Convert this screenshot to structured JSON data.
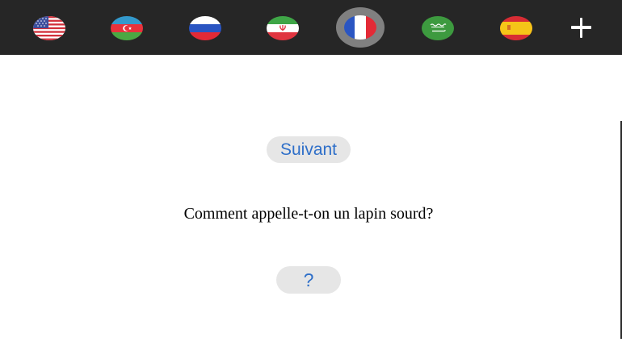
{
  "language_bar": {
    "flags": [
      {
        "icon": "us-flag-icon",
        "language": "English",
        "selected": false
      },
      {
        "icon": "azerbaijan-flag-icon",
        "language": "Azerbaijani",
        "selected": false
      },
      {
        "icon": "russia-flag-icon",
        "language": "Russian",
        "selected": false
      },
      {
        "icon": "iran-flag-icon",
        "language": "Persian",
        "selected": false
      },
      {
        "icon": "france-flag-icon",
        "language": "French",
        "selected": true
      },
      {
        "icon": "saudi-arabia-flag-icon",
        "language": "Arabic",
        "selected": false
      },
      {
        "icon": "spain-flag-icon",
        "language": "Spanish",
        "selected": false
      }
    ],
    "add_icon": "plus-icon"
  },
  "joke": {
    "next_label": "Suivant",
    "question": "Comment appelle-t-on un lapin sourd?",
    "reveal_label": "?"
  },
  "colors": {
    "topbar": "#262626",
    "selected_ring": "#808080",
    "button_bg": "#e6e6e6",
    "button_text": "#2e6fc9"
  }
}
